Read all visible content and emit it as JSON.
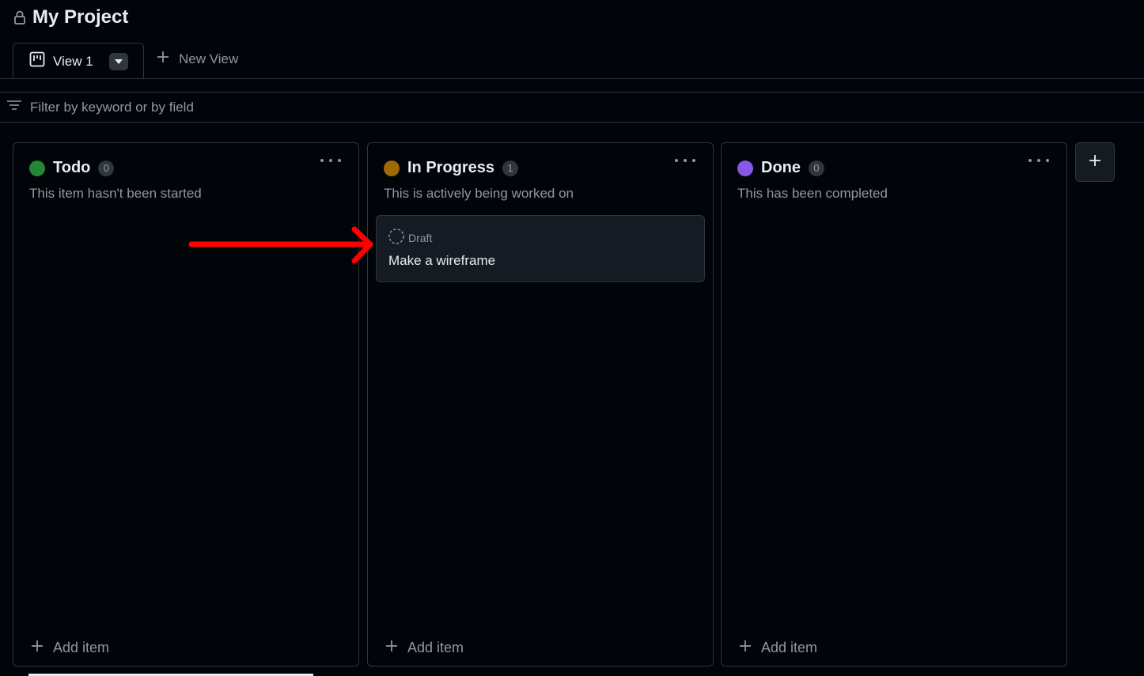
{
  "project": {
    "title": "My Project"
  },
  "tabs": [
    {
      "label": "View 1"
    }
  ],
  "new_view": {
    "label": "New View"
  },
  "filter": {
    "placeholder": "Filter by keyword or by field"
  },
  "columns": [
    {
      "title": "Todo",
      "count": "0",
      "description": "This item hasn't been started",
      "color": "#238636",
      "add_label": "Add item"
    },
    {
      "title": "In Progress",
      "count": "1",
      "description": "This is actively being worked on",
      "color": "#9e6a03",
      "add_label": "Add item",
      "cards": [
        {
          "status": "Draft",
          "title": "Make a wireframe"
        }
      ]
    },
    {
      "title": "Done",
      "count": "0",
      "description": "This has been completed",
      "color": "#8957e5",
      "add_label": "Add item"
    }
  ],
  "colors": {
    "background": "#010409",
    "border": "#30363d",
    "card": "#151b23",
    "annotation": "#ff0000"
  },
  "icons": {
    "lock": "lock-icon",
    "board": "board-icon",
    "caret": "triangle-down-icon",
    "plus": "plus-icon",
    "filter": "filter-icon",
    "kebab": "kebab-horizontal-icon",
    "draft": "dashed-circle-icon"
  }
}
